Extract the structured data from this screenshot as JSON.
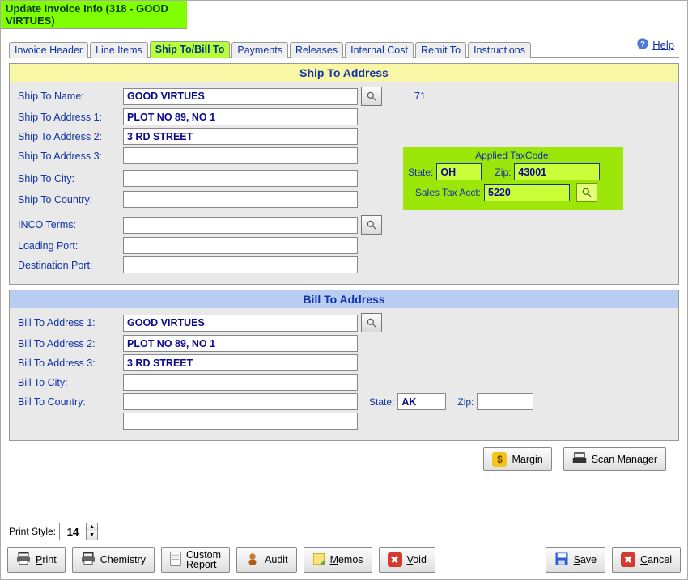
{
  "title": "Update Invoice Info  (318 - GOOD VIRTUES)",
  "help": "Help",
  "tabs": [
    {
      "label": "Invoice Header"
    },
    {
      "label": "Line Items"
    },
    {
      "label": "Ship To/Bill To",
      "active": true
    },
    {
      "label": "Payments"
    },
    {
      "label": "Releases"
    },
    {
      "label": "Internal Cost"
    },
    {
      "label": "Remit To"
    },
    {
      "label": "Instructions"
    }
  ],
  "ship": {
    "header": "Ship To Address",
    "labels": {
      "name": "Ship To Name:",
      "addr1": "Ship To Address 1:",
      "addr2": "Ship To Address 2:",
      "addr3": "Ship To Address 3:",
      "city": "Ship To City:",
      "country": "Ship To Country:",
      "inco": "INCO Terms:",
      "loading": "Loading Port:",
      "dest": "Destination Port:"
    },
    "values": {
      "name": "GOOD VIRTUES",
      "addr1": "PLOT NO 89, NO 1",
      "addr2": "3 RD STREET",
      "addr3": "",
      "city": "",
      "country": "",
      "inco": "",
      "loading": "",
      "dest": "",
      "ref": "71"
    },
    "tax": {
      "header": "Applied TaxCode:",
      "state_label": "State:",
      "state": "OH",
      "zip_label": "Zip:",
      "zip": "43001",
      "acct_label": "Sales Tax Acct:",
      "acct": "5220"
    }
  },
  "bill": {
    "header": "Bill To Address",
    "labels": {
      "addr1": "Bill To Address 1:",
      "addr2": "Bill To Address 2:",
      "addr3": "Bill To Address 3:",
      "city": "Bill To City:",
      "country": "Bill To Country:"
    },
    "values": {
      "addr1": "GOOD VIRTUES",
      "addr2": "PLOT NO 89, NO 1",
      "addr3": "3 RD STREET",
      "city": "",
      "country": "",
      "extra": "",
      "state": "AK",
      "zip": ""
    },
    "state_label": "State:",
    "zip_label": "Zip:"
  },
  "buttons": {
    "margin": "Margin",
    "scan": "Scan Manager",
    "print": "Print",
    "chemistry": "Chemistry",
    "custom": "Custom Report",
    "audit": "Audit",
    "memos": "Memos",
    "void": "Void",
    "save": "Save",
    "cancel": "Cancel"
  },
  "print_style": {
    "label": "Print Style:",
    "value": "14"
  }
}
